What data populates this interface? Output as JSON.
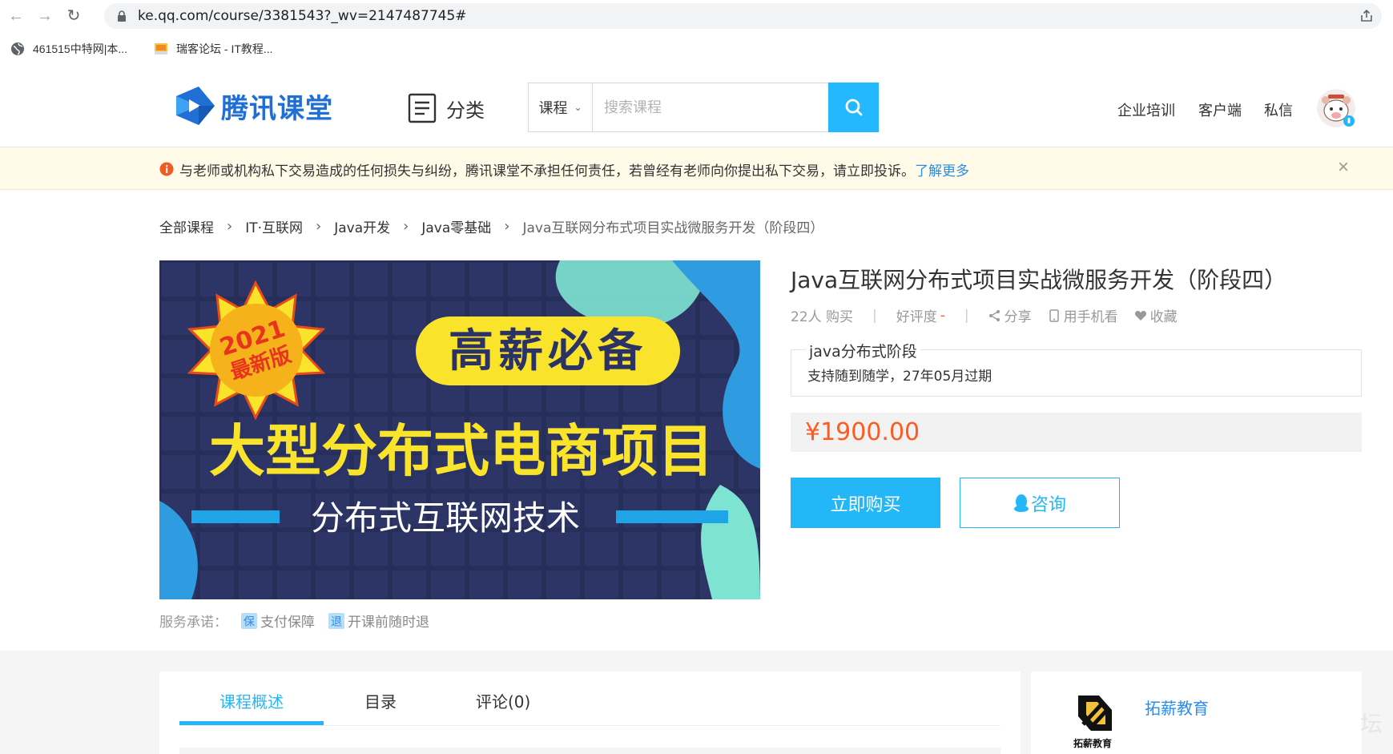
{
  "browser": {
    "url": "ke.qq.com/course/3381543?_wv=2147487745#",
    "bookmarks": [
      {
        "label": "461515中特网|本..."
      },
      {
        "label": "瑞客论坛 - IT教程..."
      }
    ]
  },
  "header": {
    "logo_text": "腾讯课堂",
    "category_label": "分类",
    "search_type": "课程",
    "search_placeholder": "搜索课程",
    "links": [
      "企业培训",
      "客户端",
      "私信"
    ]
  },
  "notice": {
    "text": "与老师或机构私下交易造成的任何损失与纠纷，腾讯课堂不承担任何责任，若曾经有老师向你提出私下交易，请立即投诉。",
    "link": "了解更多"
  },
  "breadcrumb": [
    "全部课程",
    "IT·互联网",
    "Java开发",
    "Java零基础",
    "Java互联网分布式项目实战微服务开发（阶段四）"
  ],
  "banner": {
    "badge_year": "2021",
    "badge_text": "最新版",
    "tag": "高薪必备",
    "headline": "大型分布式电商项目",
    "subline": "分布式互联网技术"
  },
  "service": {
    "label": "服务承诺：",
    "items": [
      {
        "icon_char": "保",
        "label": "支付保障"
      },
      {
        "icon_char": "退",
        "label": "开课前随时退"
      }
    ]
  },
  "course": {
    "title": "Java互联网分布式项目实战微服务开发（阶段四）",
    "buyers": "22人 购买",
    "rating_label": "好评度",
    "rating_value": "-",
    "share": "分享",
    "mobile": "用手机看",
    "favorite": "收藏",
    "plan_title": "java分布式阶段",
    "plan_desc": "支持随到随学，27年05月过期",
    "price": "¥1900.00",
    "buy_label": "立即购买",
    "consult_label": "咨询"
  },
  "tabs": [
    {
      "label": "课程概述",
      "active": true
    },
    {
      "label": "目录",
      "active": false
    },
    {
      "label": "评论(0)",
      "active": false
    }
  ],
  "org": {
    "name": "拓薪教育",
    "logo_caption": "拓薪教育"
  },
  "watermark": "坛",
  "colors": {
    "accent": "#24b7f7",
    "price": "#ff5a1f",
    "link": "#2b8ce8",
    "notice_bg": "#fffbe8"
  }
}
